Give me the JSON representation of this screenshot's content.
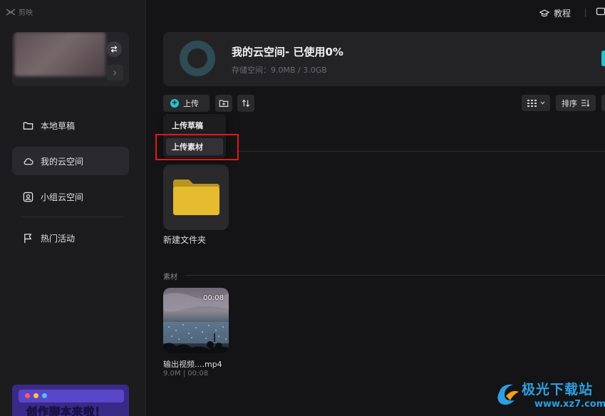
{
  "app": {
    "name": "剪映"
  },
  "header": {
    "tutorial_label": "教程"
  },
  "sidebar": {
    "items": [
      {
        "label": "本地草稿",
        "icon": "folder-icon",
        "active": false
      },
      {
        "label": "我的云空间",
        "icon": "cloud-icon",
        "active": true
      },
      {
        "label": "小组云空间",
        "icon": "team-cloud-icon",
        "active": false
      },
      {
        "label": "热门活动",
        "icon": "flag-icon",
        "active": false
      }
    ],
    "banner_text": "创作脚本来啦！"
  },
  "storage": {
    "title": "我的云空间- 已使用0%",
    "subtitle": "存储空间：9.0MB / 3.0GB",
    "used_percent": 0
  },
  "toolbar": {
    "upload_label": "上传",
    "sort_label": "排序"
  },
  "upload_menu": {
    "items": [
      "上传草稿",
      "上传素材"
    ],
    "highlighted": "上传素材"
  },
  "folders": [
    {
      "name": "新建文件夹"
    }
  ],
  "materials": {
    "section_label": "素材",
    "items": [
      {
        "name": "输出视频....mp4",
        "duration": "00:08",
        "meta": "9.0M | 00:08"
      }
    ]
  },
  "watermark": {
    "text": "极光下载站",
    "url": "www.xz7.com"
  },
  "colors": {
    "accent": "#27c2cf",
    "highlight_box": "#e11919",
    "folder": "#e6bc2f"
  }
}
